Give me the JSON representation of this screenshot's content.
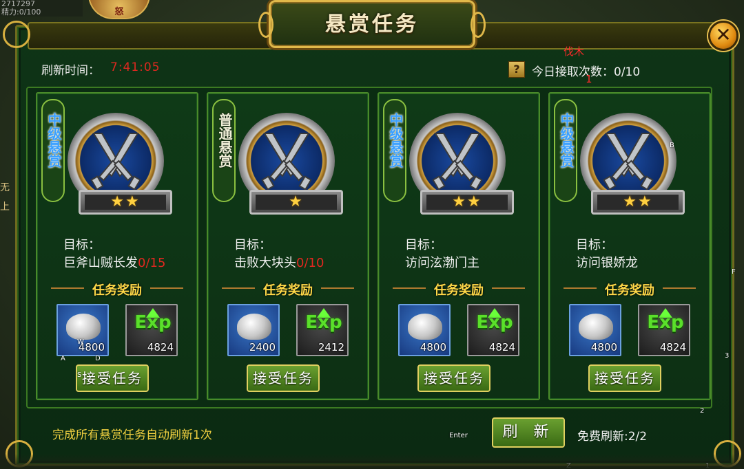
{
  "hud": {
    "top_left_line1": "2717297",
    "top_left_line2": "精力:0/100",
    "emblem_text": "怒",
    "side_text_1": "无",
    "side_text_2": "上"
  },
  "window": {
    "title": "悬赏任务",
    "close_glyph": "✕"
  },
  "header": {
    "refresh_label": "刷新时间：",
    "refresh_time": "7:41:05",
    "daily_label": "今日接取次数：0/10",
    "help_glyph": "?",
    "floating_red_1": "伐木",
    "floating_red_2": "1"
  },
  "cards": [
    {
      "rank": "中级悬赏",
      "rank_style": "mid",
      "stars": "★★",
      "goal_label": "目标：",
      "goal": "巨斧山贼长发",
      "progress": "0/15",
      "reward_title": "任务奖励",
      "silver": "4800",
      "exp": "4824",
      "accept": "接受任务"
    },
    {
      "rank": "普通悬赏",
      "rank_style": "normal",
      "stars": "★",
      "goal_label": "目标：",
      "goal": "击败大块头",
      "progress": "0/10",
      "reward_title": "任务奖励",
      "silver": "2400",
      "exp": "2412",
      "accept": "接受任务"
    },
    {
      "rank": "中级悬赏",
      "rank_style": "mid",
      "stars": "★★",
      "goal_label": "目标：",
      "goal": "访问泫渤门主",
      "progress": "",
      "reward_title": "任务奖励",
      "silver": "4800",
      "exp": "4824",
      "accept": "接受任务"
    },
    {
      "rank": "中级悬赏",
      "rank_style": "mid",
      "stars": "★★",
      "goal_label": "目标：",
      "goal": "访问银娇龙",
      "progress": "",
      "reward_title": "任务奖励",
      "silver": "4800",
      "exp": "4824",
      "accept": "接受任务"
    }
  ],
  "exp_glyph": "Exp",
  "footer": {
    "auto_refresh_text": "完成所有悬赏任务自动刷新1次",
    "refresh_button": "刷 新",
    "free_refresh": "免费刷新:2/2"
  },
  "key_hints": {
    "enter": "Enter",
    "a": "A",
    "d": "D",
    "w": "W",
    "s": "S",
    "b": "B",
    "f": "F",
    "three": "3",
    "two": "2",
    "one": "1",
    "z": "Z"
  },
  "colors": {
    "accent_gold": "#ffd848",
    "progress_red": "#e02820",
    "button_green": "#4a8022",
    "panel_green": "#0e3416",
    "rank_blue": "#3aa0ff"
  }
}
